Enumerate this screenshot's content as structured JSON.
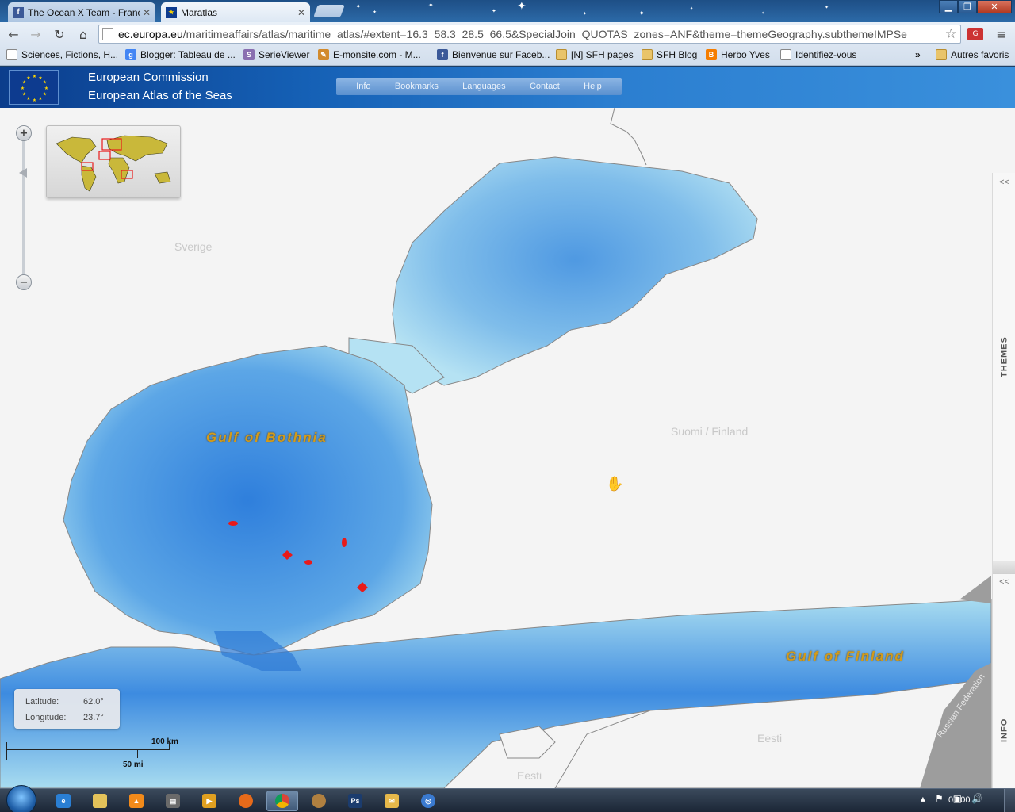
{
  "browser": {
    "tabs": [
      {
        "title": "The Ocean X Team - Franc",
        "favicon": "facebook-icon",
        "active": false
      },
      {
        "title": "Maratlas",
        "favicon": "eu-flag-icon",
        "active": true
      }
    ],
    "url_domain": "ec.europa.eu",
    "url_path": "/maritimeaffairs/atlas/maritime_atlas/#extent=16.3_58.3_28.5_66.5&SpecialJoin_QUOTAS_zones=ANF&theme=themeGeography.subthemeIMPSe",
    "bookmarks": [
      {
        "label": "Sciences, Fictions, H...",
        "icon": "page-icon"
      },
      {
        "label": "Blogger: Tableau de ...",
        "icon": "google-icon"
      },
      {
        "label": "SerieViewer",
        "icon": "serieviewer-icon"
      },
      {
        "label": "E-monsite.com - M...",
        "icon": "emonsite-icon"
      },
      {
        "label": "Bienvenue sur Faceb...",
        "icon": "facebook-icon"
      },
      {
        "label": "[N] SFH pages",
        "icon": "folder-icon"
      },
      {
        "label": "SFH Blog",
        "icon": "folder-icon"
      },
      {
        "label": "Herbo Yves",
        "icon": "blogger-icon"
      },
      {
        "label": "Identifiez-vous",
        "icon": "page-icon"
      }
    ],
    "bookmarks_overflow": "»",
    "other_bookmarks": "Autres favoris"
  },
  "header": {
    "org": "European Commission",
    "app": "European Atlas of the Seas",
    "menu": [
      "Info",
      "Bookmarks",
      "Languages",
      "Contact",
      "Help"
    ]
  },
  "map": {
    "land_labels": {
      "sverige": "Sverige",
      "finland": "Suomi / Finland",
      "eesti_1": "Eesti",
      "eesti_2": "Eesti",
      "russia": "Russian Federation"
    },
    "sea_labels": {
      "bothnia": "Gulf of Bothnia",
      "finland": "Gulf of Finland"
    },
    "side_panel": {
      "collapse_symbol": "<<",
      "themes": "THEMES",
      "info": "INFO"
    },
    "coordinates": {
      "latitude_label": "Latitude:",
      "latitude_value": "62.0°",
      "longitude_label": "Longitude:",
      "longitude_value": "23.7°"
    },
    "scale": {
      "km": "100 km",
      "mi": "50 mi"
    },
    "colors": {
      "deep_sea": "#2f7fdc",
      "shallow_sea": "#a8dcf0",
      "land": "#f4f4f4",
      "quota_zone": "#e81a1a",
      "label_gold": "#d39b1a"
    }
  },
  "taskbar": {
    "clock": "07:00"
  }
}
